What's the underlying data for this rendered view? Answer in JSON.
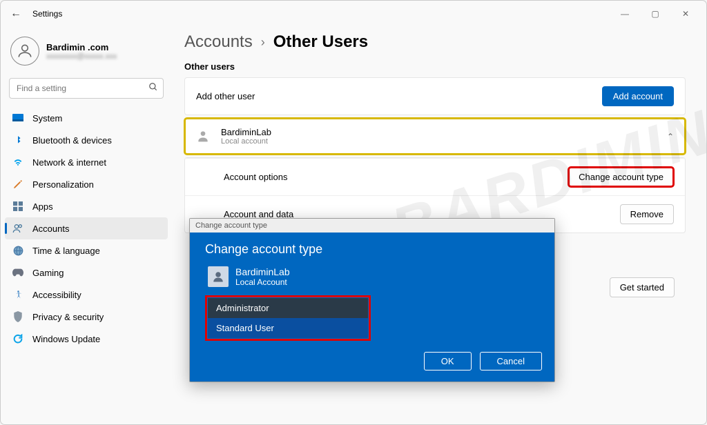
{
  "windowTitle": "Settings",
  "currentUser": {
    "name": "Bardimin .com",
    "email": "xxxxxxxx@xxxxx.xxx"
  },
  "search": {
    "placeholder": "Find a setting"
  },
  "nav": [
    {
      "label": "System"
    },
    {
      "label": "Bluetooth & devices"
    },
    {
      "label": "Network & internet"
    },
    {
      "label": "Personalization"
    },
    {
      "label": "Apps"
    },
    {
      "label": "Accounts"
    },
    {
      "label": "Time & language"
    },
    {
      "label": "Gaming"
    },
    {
      "label": "Accessibility"
    },
    {
      "label": "Privacy & security"
    },
    {
      "label": "Windows Update"
    }
  ],
  "breadcrumb": {
    "section": "Accounts",
    "page": "Other Users"
  },
  "otherUsers": {
    "heading": "Other users",
    "addLabel": "Add other user",
    "addButton": "Add account",
    "entry": {
      "name": "BardiminLab",
      "type": "Local account"
    },
    "accountOptionsLabel": "Account options",
    "changeTypeButton": "Change account type",
    "accountDataLabel": "Account and data",
    "removeButton": "Remove",
    "getStarted": "Get started"
  },
  "dialog": {
    "titlebar": "Change account type",
    "heading": "Change account type",
    "userName": "BardiminLab",
    "userType": "Local Account",
    "options": {
      "admin": "Administrator",
      "standard": "Standard User"
    },
    "ok": "OK",
    "cancel": "Cancel"
  },
  "watermark": "BARDIMIN"
}
